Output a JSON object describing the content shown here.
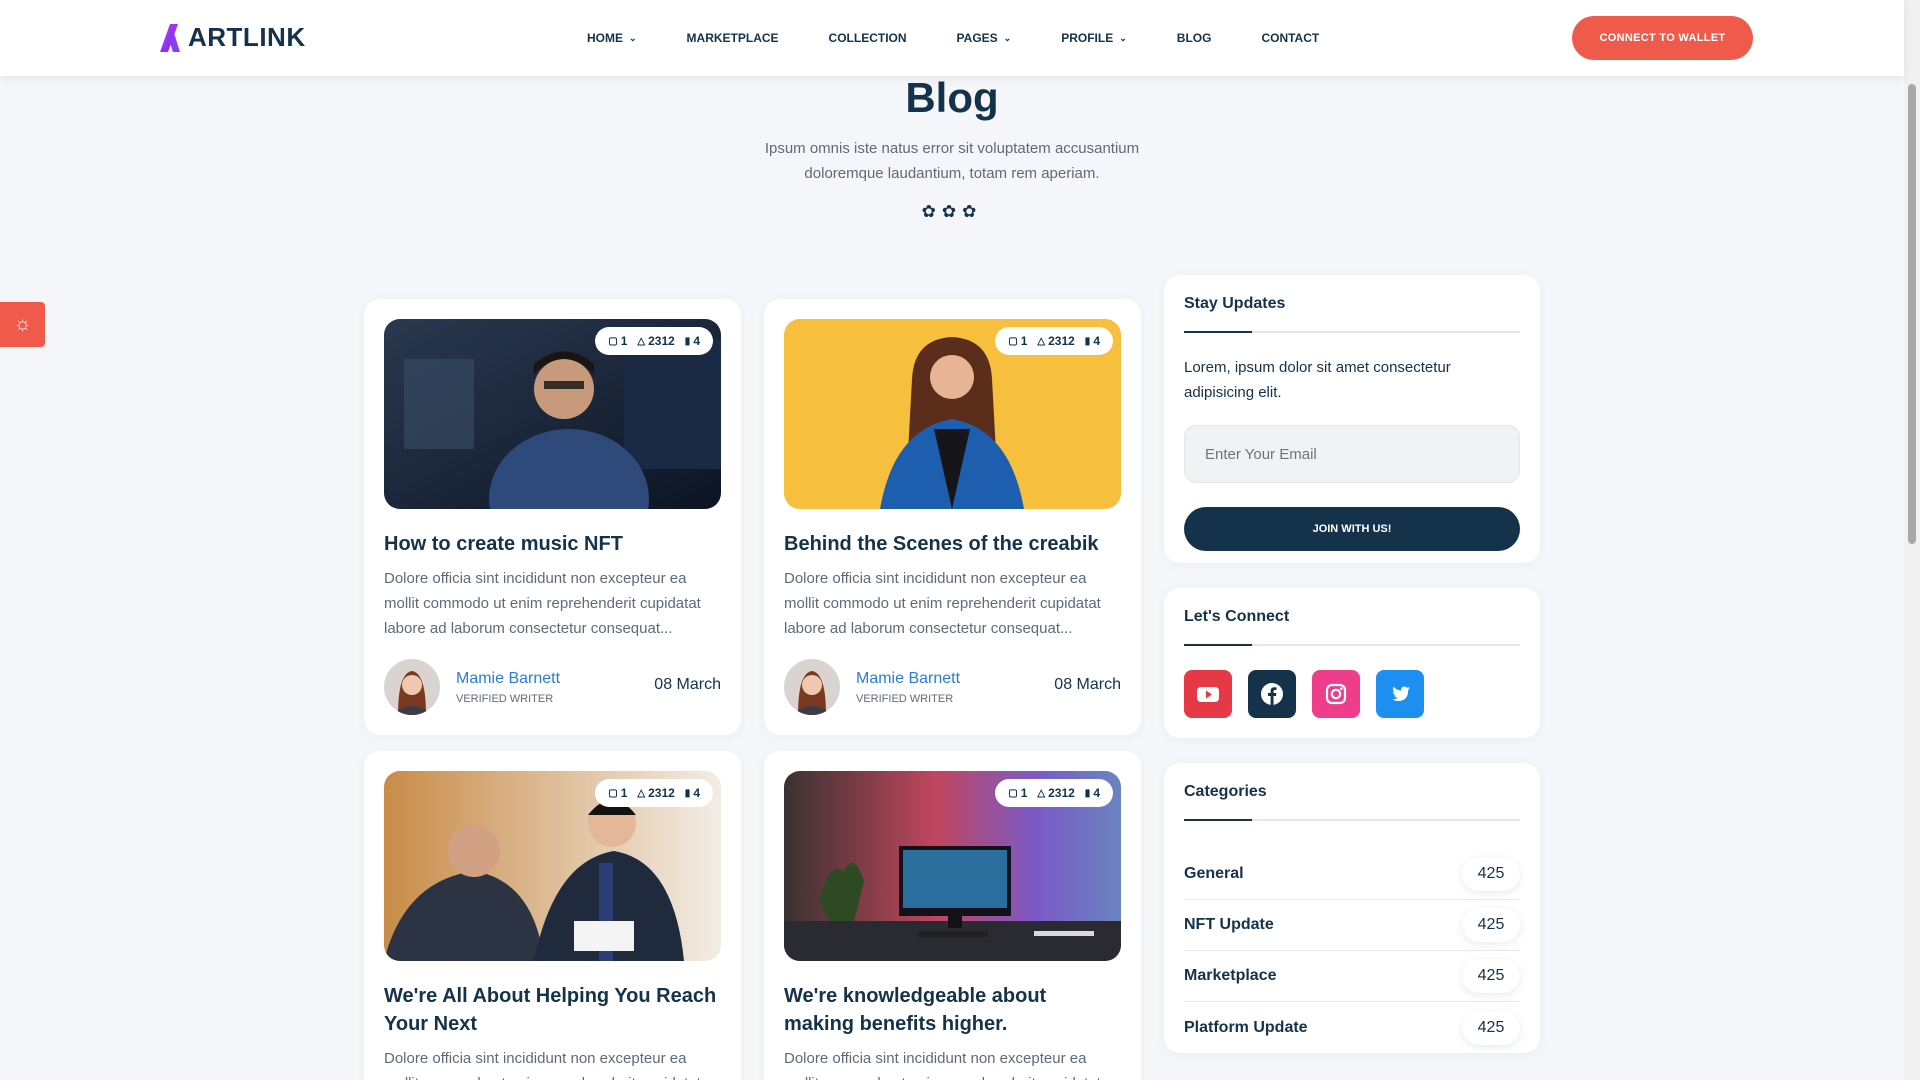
{
  "header": {
    "logo_text": "ARTLINK",
    "nav": [
      {
        "label": "HOME",
        "has_dropdown": true
      },
      {
        "label": "MARKETPLACE",
        "has_dropdown": false
      },
      {
        "label": "COLLECTION",
        "has_dropdown": false
      },
      {
        "label": "PAGES",
        "has_dropdown": true
      },
      {
        "label": "PROFILE",
        "has_dropdown": true
      },
      {
        "label": "BLOG",
        "has_dropdown": false
      },
      {
        "label": "CONTACT",
        "has_dropdown": false
      }
    ],
    "wallet_button": "CONNECT TO WALLET"
  },
  "hero": {
    "title": "Blog",
    "subtitle": "Ipsum omnis iste natus error sit voluptatem accusantium doloremque laudantium, totam rem aperiam."
  },
  "posts": [
    {
      "title": "How to create music NFT",
      "excerpt": "Dolore officia sint incididunt non excepteur ea mollit commodo ut enim reprehenderit cupidatat labore ad laborum consectetur consequat...",
      "comments": "1",
      "likes": "2312",
      "shares": "4",
      "author": "Mamie Barnett",
      "role": "VERIFIED WRITER",
      "date": "08 March"
    },
    {
      "title": "Behind the Scenes of the creabik",
      "excerpt": "Dolore officia sint incididunt non excepteur ea mollit commodo ut enim reprehenderit cupidatat labore ad laborum consectetur consequat...",
      "comments": "1",
      "likes": "2312",
      "shares": "4",
      "author": "Mamie Barnett",
      "role": "VERIFIED WRITER",
      "date": "08 March"
    },
    {
      "title": "We're All About Helping You Reach Your Next",
      "excerpt": "Dolore officia sint incididunt non excepteur ea mollit commodo ut enim reprehenderit cupidatat labore ad laborum consectetur consequat...",
      "comments": "1",
      "likes": "2312",
      "shares": "4"
    },
    {
      "title": "We're knowledgeable about making benefits higher.",
      "excerpt": "Dolore officia sint incididunt non excepteur ea mollit commodo ut enim reprehenderit cupidatat labore ad laborum consectetur consequat...",
      "comments": "1",
      "likes": "2312",
      "shares": "4"
    }
  ],
  "sidebar": {
    "newsletter": {
      "title": "Stay Updates",
      "text": "Lorem, ipsum dolor sit amet consectetur adipisicing elit.",
      "email_placeholder": "Enter Your Email",
      "email_value": "",
      "button": "JOIN WITH US!"
    },
    "connect": {
      "title": "Let's Connect",
      "socials": [
        {
          "name": "youtube-icon",
          "color": "#e63946"
        },
        {
          "name": "facebook-icon",
          "color": "#14324a"
        },
        {
          "name": "instagram-icon",
          "color": "#ee3e8b"
        },
        {
          "name": "twitter-icon",
          "color": "#1d8ff0"
        }
      ]
    },
    "categories": {
      "title": "Categories",
      "items": [
        {
          "name": "General",
          "count": "425"
        },
        {
          "name": "NFT Update",
          "count": "425"
        },
        {
          "name": "Marketplace",
          "count": "425"
        },
        {
          "name": "Platform Update",
          "count": "425"
        }
      ]
    }
  },
  "colors": {
    "accent": "#ef5a4a",
    "navy": "#14324a",
    "link": "#2b7cd3",
    "background": "#f4f6f9"
  }
}
